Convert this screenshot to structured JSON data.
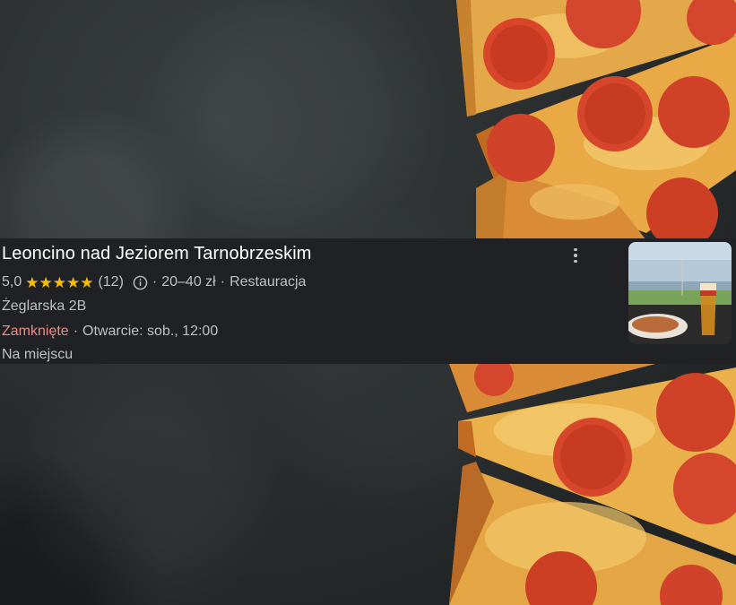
{
  "listing": {
    "name": "Leoncino nad Jeziorem Tarnobrzeskim",
    "rating": "5,0",
    "stars": "★★★★★",
    "reviews": "(12)",
    "price": "20–40 zł",
    "category": "Restauracja",
    "separator": "·",
    "address": "Żeglarska 2B",
    "status": "Zamknięte",
    "hours": "Otwarcie: sob., 12:00",
    "service": "Na miejscu",
    "status_color": "#f28b82",
    "star_color": "#fbbc04"
  },
  "icons": {
    "info": "info-icon",
    "more": "more-vert-icon"
  }
}
